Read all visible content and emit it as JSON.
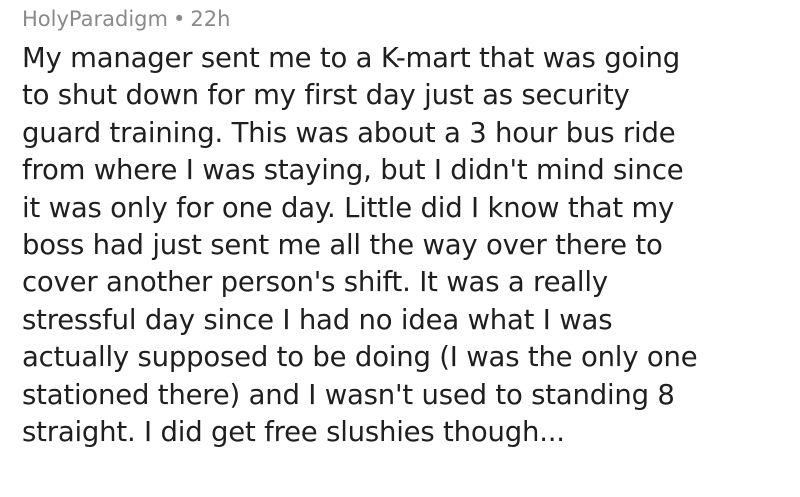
{
  "comment": {
    "author": "HolyParadigm",
    "separator": "•",
    "age": "22h",
    "lines": [
      "My manager sent me to a K-mart that was going",
      "to shut down for my first day just as security",
      "guard training. This was about a 3 hour bus ride",
      "from where I was staying, but I didn't mind since",
      "it was only for one day. Little did I know that my",
      "boss had just sent me all the way over there to",
      "cover another person's shift. It was a really",
      "stressful day since I had no idea what I was",
      "actually supposed to be doing (I was the only one",
      "stationed there) and I wasn't used to standing 8",
      "straight. I did get free slushies though..."
    ]
  }
}
